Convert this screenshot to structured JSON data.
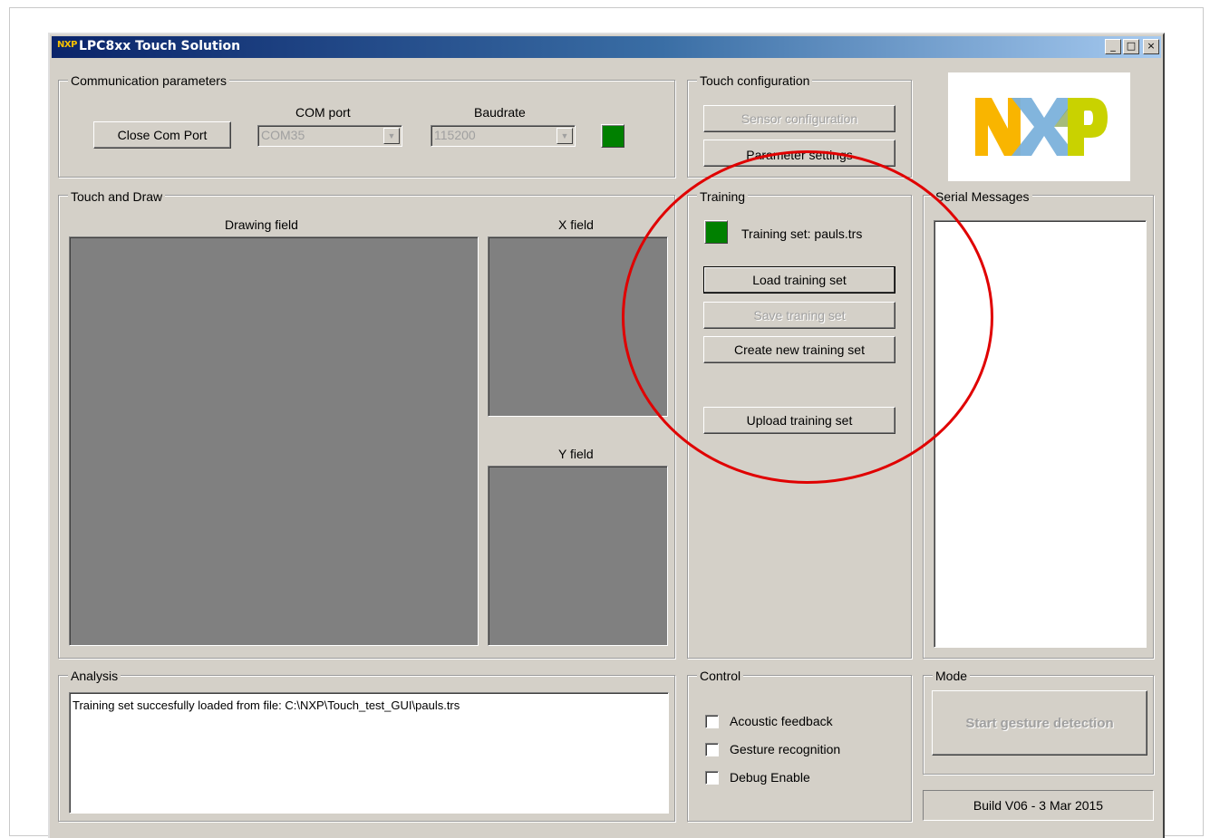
{
  "window": {
    "title": "LPC8xx Touch Solution",
    "title_logo": "NXP",
    "minimize": "_",
    "maximize": "□",
    "close": "×"
  },
  "communication": {
    "label": "Communication parameters",
    "close_button": "Close Com Port",
    "com_port_label": "COM port",
    "com_port_value": "COM35",
    "baudrate_label": "Baudrate",
    "baudrate_value": "115200",
    "status_color": "#008000"
  },
  "touch_config": {
    "label": "Touch configuration",
    "sensor_button": "Sensor configuration",
    "parameter_button": "Parameter settings"
  },
  "logo": {
    "text": "NXP",
    "colors": [
      "#f9b500",
      "#7bb1db",
      "#c9d200"
    ]
  },
  "touch_draw": {
    "label": "Touch and Draw",
    "drawing_field": "Drawing field",
    "x_field": "X field",
    "y_field": "Y field"
  },
  "training": {
    "label": "Training",
    "status_text": "Training set: pauls.trs",
    "load_button": "Load training set",
    "save_button": "Save traning set",
    "create_button": "Create new training set",
    "upload_button": "Upload training set"
  },
  "serial": {
    "label": "Serial Messages"
  },
  "analysis": {
    "label": "Analysis",
    "text": "Training set succesfully loaded from file: C:\\NXP\\Touch_test_GUI\\pauls.trs"
  },
  "control": {
    "label": "Control",
    "acoustic": "Acoustic feedback",
    "gesture": "Gesture recognition",
    "debug": "Debug Enable"
  },
  "mode": {
    "label": "Mode",
    "start_button": "Start gesture detection",
    "build": "Build V06  -  3 Mar 2015"
  },
  "annotation": {
    "color": "#e00000"
  }
}
